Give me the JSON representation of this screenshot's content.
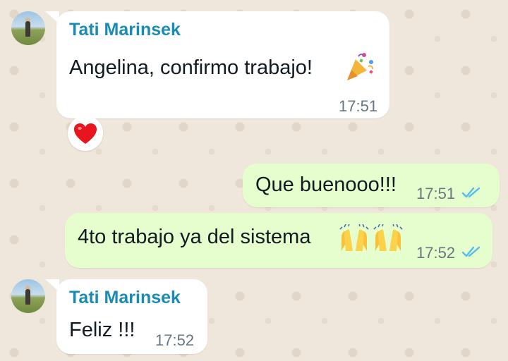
{
  "chat": {
    "messages": [
      {
        "direction": "incoming",
        "sender": "Tati Marinsek",
        "text": "Angelina, confirmo trabajo!",
        "emoji": "party-popper",
        "time": "17:51",
        "reaction": "red-heart"
      },
      {
        "direction": "outgoing",
        "text": "Que buenooo!!!",
        "time": "17:51",
        "status": "read"
      },
      {
        "direction": "outgoing",
        "text": "4to trabajo ya del sistema",
        "emoji": "raising-hands x2",
        "time": "17:52",
        "status": "read"
      },
      {
        "direction": "incoming",
        "sender": "Tati Marinsek",
        "text": "Feliz !!!",
        "time": "17:52"
      }
    ]
  },
  "colors": {
    "sender_name": "#1a8bb2",
    "incoming_bubble": "#ffffff",
    "outgoing_bubble": "#e6fecd",
    "read_ticks": "#53bdeb",
    "timestamp": "#667781",
    "wallpaper": "#efe7dc"
  }
}
